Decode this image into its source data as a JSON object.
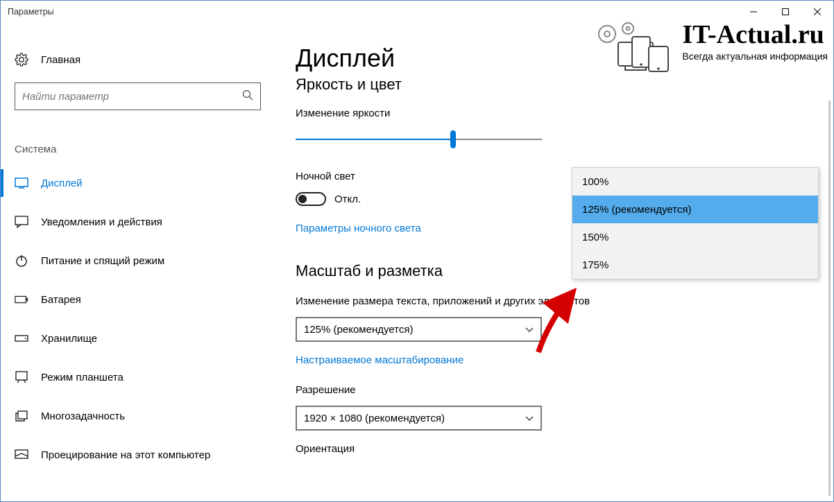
{
  "window_title": "Параметры",
  "home_label": "Главная",
  "search_placeholder": "Найти параметр",
  "category_heading": "Система",
  "sidebar": {
    "items": [
      {
        "label": "Дисплей"
      },
      {
        "label": "Уведомления и действия"
      },
      {
        "label": "Питание и спящий режим"
      },
      {
        "label": "Батарея"
      },
      {
        "label": "Хранилище"
      },
      {
        "label": "Режим планшета"
      },
      {
        "label": "Многозадачность"
      },
      {
        "label": "Проецирование на этот компьютер"
      }
    ]
  },
  "main": {
    "page_title": "Дисплей",
    "section1_title": "Яркость и цвет",
    "brightness_label": "Изменение яркости",
    "brightness_value_percent": 64,
    "night_light_label": "Ночной свет",
    "night_light_state": "Откл.",
    "night_light_settings_link": "Параметры ночного света",
    "section2_title": "Масштаб и разметка",
    "scale_label": "Изменение размера текста, приложений и других элементов",
    "scale_selected": "125% (рекомендуется)",
    "custom_scaling_link": "Настраиваемое масштабирование",
    "resolution_label": "Разрешение",
    "resolution_selected": "1920 × 1080 (рекомендуется)",
    "orientation_label": "Ориентация"
  },
  "scale_options": [
    "100%",
    "125% (рекомендуется)",
    "150%",
    "175%"
  ],
  "watermark": {
    "title": "IT-Actual.ru",
    "subtitle": "Всегда актуальная информация"
  }
}
